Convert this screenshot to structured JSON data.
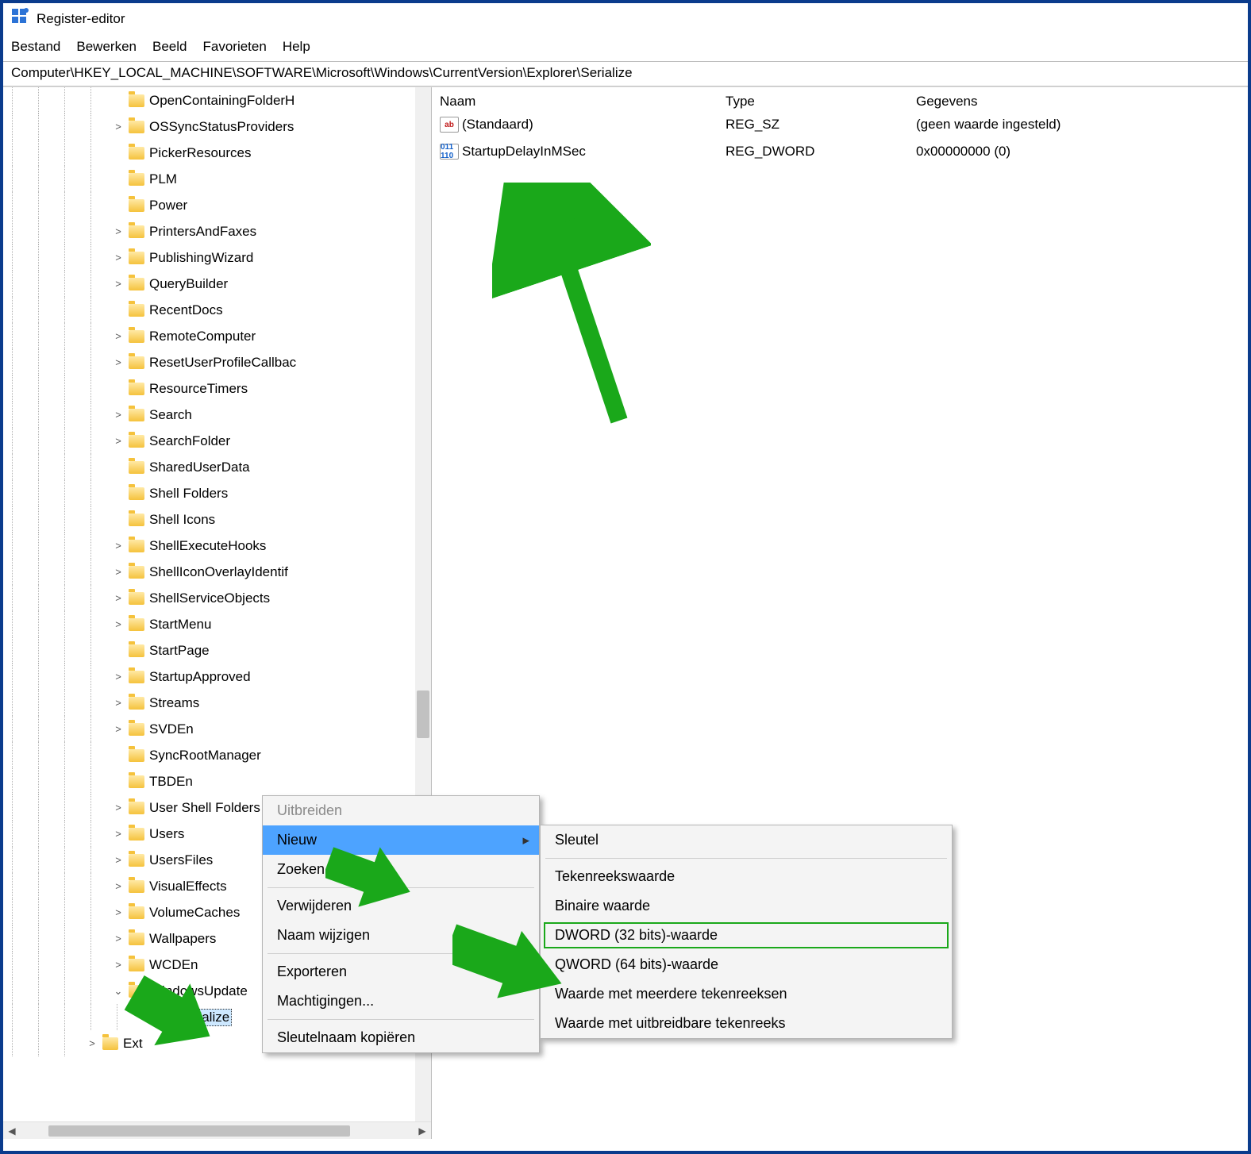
{
  "title": "Register-editor",
  "menu": [
    "Bestand",
    "Bewerken",
    "Beeld",
    "Favorieten",
    "Help"
  ],
  "address": "Computer\\HKEY_LOCAL_MACHINE\\SOFTWARE\\Microsoft\\Windows\\CurrentVersion\\Explorer\\Serialize",
  "columns": {
    "name": "Naam",
    "type": "Type",
    "data": "Gegevens"
  },
  "values": [
    {
      "icon": "str",
      "name": "(Standaard)",
      "type": "REG_SZ",
      "data": "(geen waarde ingesteld)"
    },
    {
      "icon": "bin",
      "name": "StartupDelayInMSec",
      "type": "REG_DWORD",
      "data": "0x00000000 (0)"
    }
  ],
  "tree": [
    {
      "chev": "none",
      "depth": 7,
      "label": "OpenContainingFolderH"
    },
    {
      "chev": "right",
      "depth": 7,
      "label": "OSSyncStatusProviders"
    },
    {
      "chev": "none",
      "depth": 7,
      "label": "PickerResources"
    },
    {
      "chev": "none",
      "depth": 7,
      "label": "PLM"
    },
    {
      "chev": "none",
      "depth": 7,
      "label": "Power"
    },
    {
      "chev": "right",
      "depth": 7,
      "label": "PrintersAndFaxes"
    },
    {
      "chev": "right",
      "depth": 7,
      "label": "PublishingWizard"
    },
    {
      "chev": "right",
      "depth": 7,
      "label": "QueryBuilder"
    },
    {
      "chev": "none",
      "depth": 7,
      "label": "RecentDocs"
    },
    {
      "chev": "right",
      "depth": 7,
      "label": "RemoteComputer"
    },
    {
      "chev": "right",
      "depth": 7,
      "label": "ResetUserProfileCallbac"
    },
    {
      "chev": "none",
      "depth": 7,
      "label": "ResourceTimers"
    },
    {
      "chev": "right",
      "depth": 7,
      "label": "Search"
    },
    {
      "chev": "right",
      "depth": 7,
      "label": "SearchFolder"
    },
    {
      "chev": "none",
      "depth": 7,
      "label": "SharedUserData"
    },
    {
      "chev": "none",
      "depth": 7,
      "label": "Shell Folders"
    },
    {
      "chev": "none",
      "depth": 7,
      "label": "Shell Icons"
    },
    {
      "chev": "right",
      "depth": 7,
      "label": "ShellExecuteHooks"
    },
    {
      "chev": "right",
      "depth": 7,
      "label": "ShellIconOverlayIdentif"
    },
    {
      "chev": "right",
      "depth": 7,
      "label": "ShellServiceObjects"
    },
    {
      "chev": "right",
      "depth": 7,
      "label": "StartMenu"
    },
    {
      "chev": "none",
      "depth": 7,
      "label": "StartPage"
    },
    {
      "chev": "right",
      "depth": 7,
      "label": "StartupApproved"
    },
    {
      "chev": "right",
      "depth": 7,
      "label": "Streams"
    },
    {
      "chev": "right",
      "depth": 7,
      "label": "SVDEn"
    },
    {
      "chev": "none",
      "depth": 7,
      "label": "SyncRootManager"
    },
    {
      "chev": "none",
      "depth": 7,
      "label": "TBDEn"
    },
    {
      "chev": "right",
      "depth": 7,
      "label": "User Shell Folders"
    },
    {
      "chev": "right",
      "depth": 7,
      "label": "Users"
    },
    {
      "chev": "right",
      "depth": 7,
      "label": "UsersFiles"
    },
    {
      "chev": "right",
      "depth": 7,
      "label": "VisualEffects"
    },
    {
      "chev": "right",
      "depth": 7,
      "label": "VolumeCaches"
    },
    {
      "chev": "right",
      "depth": 7,
      "label": "Wallpapers"
    },
    {
      "chev": "right",
      "depth": 7,
      "label": "WCDEn"
    },
    {
      "chev": "down",
      "depth": 7,
      "label": "WindowsUpdate"
    },
    {
      "chev": "none",
      "depth": 8,
      "label": "Serialize",
      "selected": true
    },
    {
      "chev": "right",
      "depth": 6,
      "label": "Ext"
    }
  ],
  "ctx1": {
    "items": [
      {
        "label": "Uitbreiden",
        "disabled": true
      },
      {
        "label": "Nieuw",
        "hover": true,
        "sub": true
      },
      {
        "label": "Zoeken..."
      },
      {
        "sep": true
      },
      {
        "label": "Verwijderen"
      },
      {
        "label": "Naam wijzigen"
      },
      {
        "sep": true
      },
      {
        "label": "Exporteren"
      },
      {
        "label": "Machtigingen..."
      },
      {
        "sep": true
      },
      {
        "label": "Sleutelnaam kopiëren"
      }
    ]
  },
  "ctx2": {
    "items": [
      {
        "label": "Sleutel"
      },
      {
        "sep": true
      },
      {
        "label": "Tekenreekswaarde"
      },
      {
        "label": "Binaire waarde"
      },
      {
        "label": "DWORD (32 bits)-waarde",
        "highlight": true
      },
      {
        "label": "QWORD (64 bits)-waarde"
      },
      {
        "label": "Waarde met meerdere tekenreeksen"
      },
      {
        "label": "Waarde met uitbreidbare tekenreeks"
      }
    ]
  }
}
